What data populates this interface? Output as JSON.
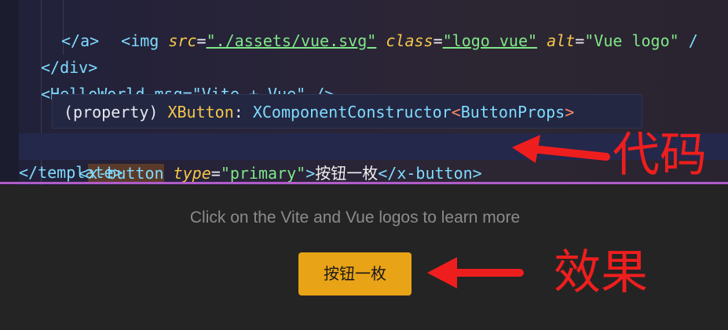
{
  "editor": {
    "line1": {
      "open": "<img ",
      "attr1": "src",
      "eq1": "=",
      "val1": "\"./assets/vue.svg\"",
      "attr2": "class",
      "eq2": "=",
      "val2": "\"logo vue\"",
      "attr3": "alt",
      "eq3": "=",
      "val3": "\"Vue logo\"",
      "tail": " /"
    },
    "line2": "</a>",
    "line3": "</div>",
    "line4": "<HelloWorld msg=\"Vite + Vue\" />",
    "hover": {
      "prefix": "(property) ",
      "name": "XButton",
      "colon": ": ",
      "type": "XComponentConstructor",
      "lt": "<",
      "generic": "ButtonProps",
      "gt": ">"
    },
    "line5": {
      "lt": "<",
      "tag": "x-button",
      "attr": "type",
      "eq": "=",
      "val": "\"primary\"",
      "gt": ">",
      "content": "按钮一枚",
      "close": "</x-button>"
    },
    "line6": "</template>"
  },
  "annotations": {
    "code_label": "代码",
    "effect_label": "效果",
    "color": "#ef1e1e"
  },
  "app": {
    "read_the_docs": "Click on the Vite and Vue logos to learn more",
    "button_label": "按钮一枚",
    "button_color": "#e8a316"
  }
}
